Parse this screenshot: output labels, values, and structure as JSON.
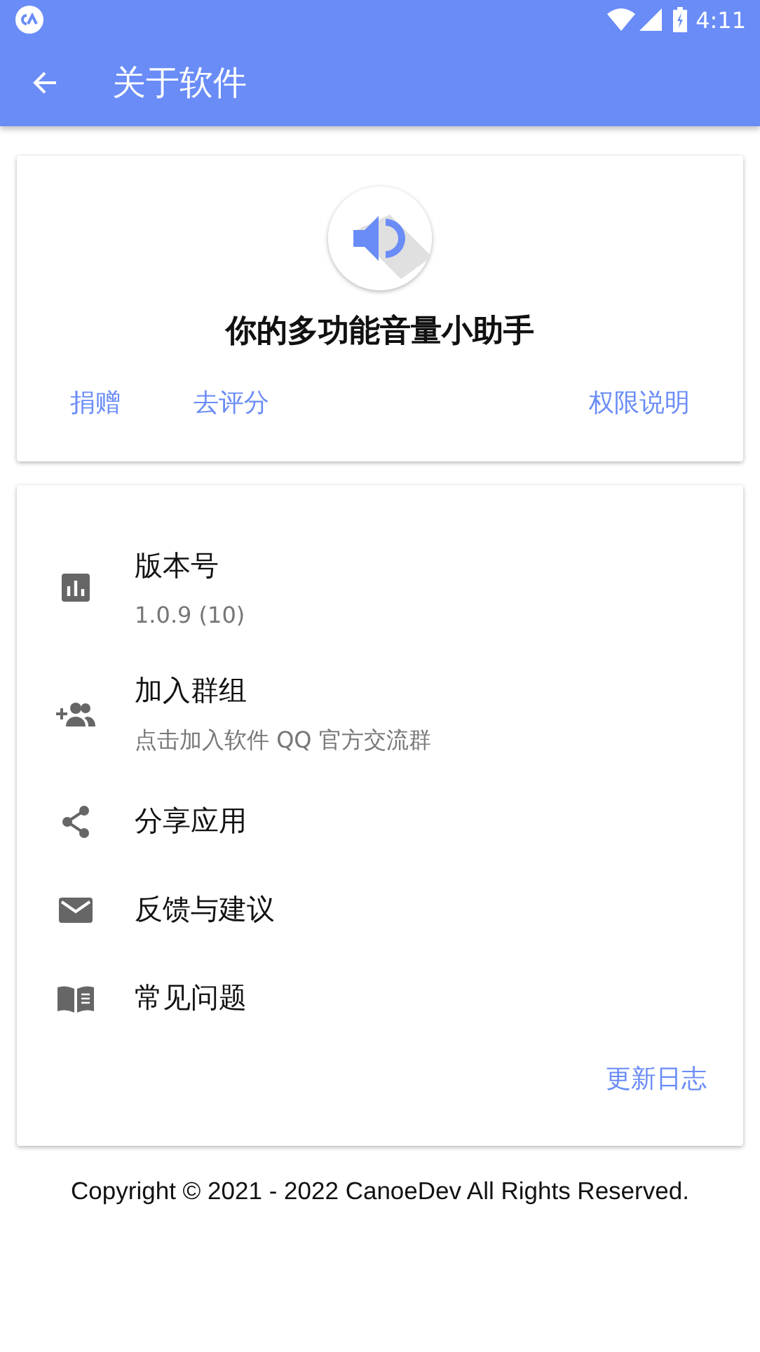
{
  "status_bar": {
    "time": "4:11"
  },
  "app_bar": {
    "title": "关于软件"
  },
  "about_card": {
    "tagline": "你的多功能音量小助手",
    "leading_actions": [
      "捐赠",
      "去评分"
    ],
    "trailing_actions": [
      "权限说明"
    ]
  },
  "info_list": {
    "items": [
      {
        "title": "版本号",
        "subtitle": "1.0.9 (10)"
      },
      {
        "title": "加入群组",
        "subtitle": "点击加入软件 QQ 官方交流群"
      },
      {
        "title": "分享应用"
      },
      {
        "title": "反馈与建议"
      },
      {
        "title": "常见问题"
      }
    ],
    "footer_link": "更新日志"
  },
  "copyright": "Copyright © 2021 - 2022 CanoeDev All Rights Reserved."
}
